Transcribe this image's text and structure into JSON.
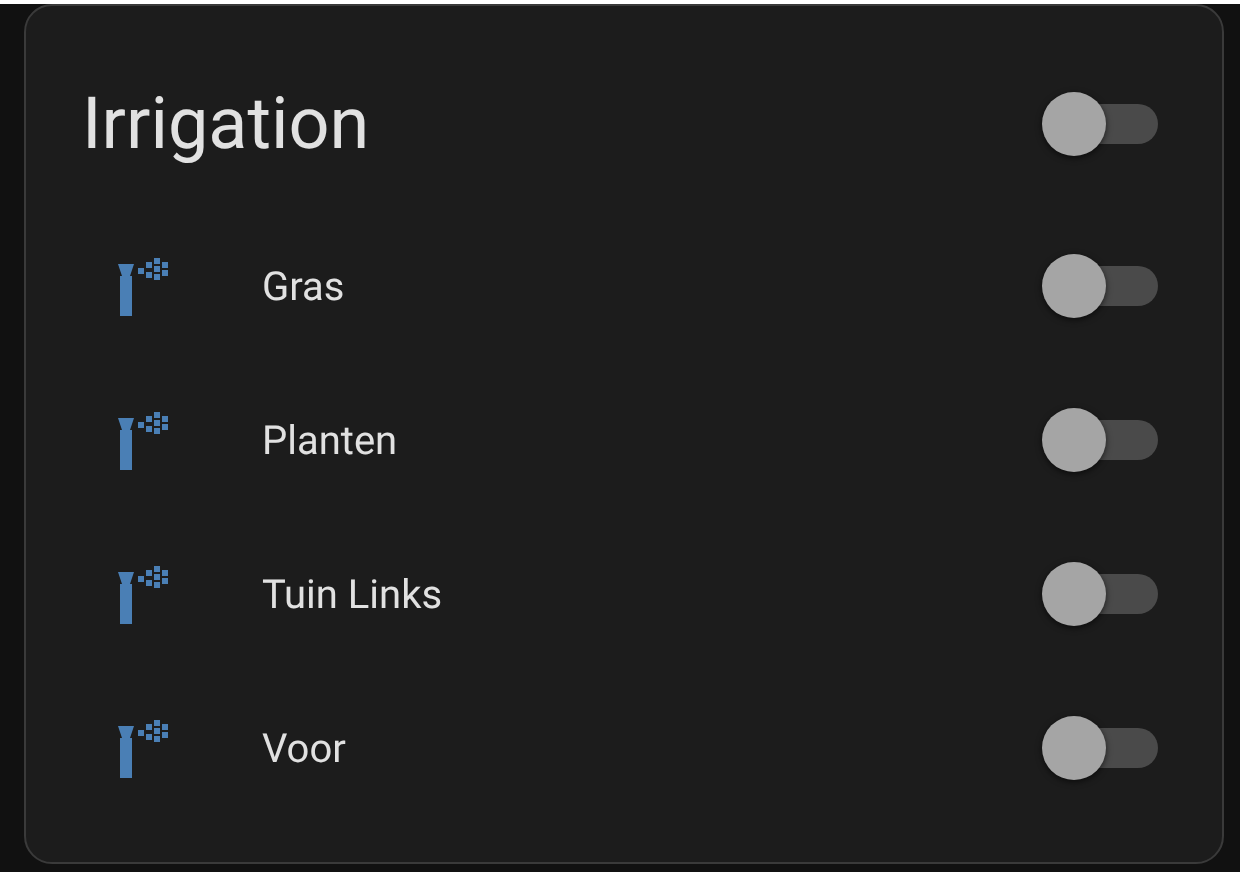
{
  "card": {
    "title": "Irrigation",
    "on": false
  },
  "switches": [
    {
      "name": "Gras",
      "on": false
    },
    {
      "name": "Planten",
      "on": false
    },
    {
      "name": "Tuin Links",
      "on": false
    },
    {
      "name": "Voor",
      "on": false
    }
  ]
}
